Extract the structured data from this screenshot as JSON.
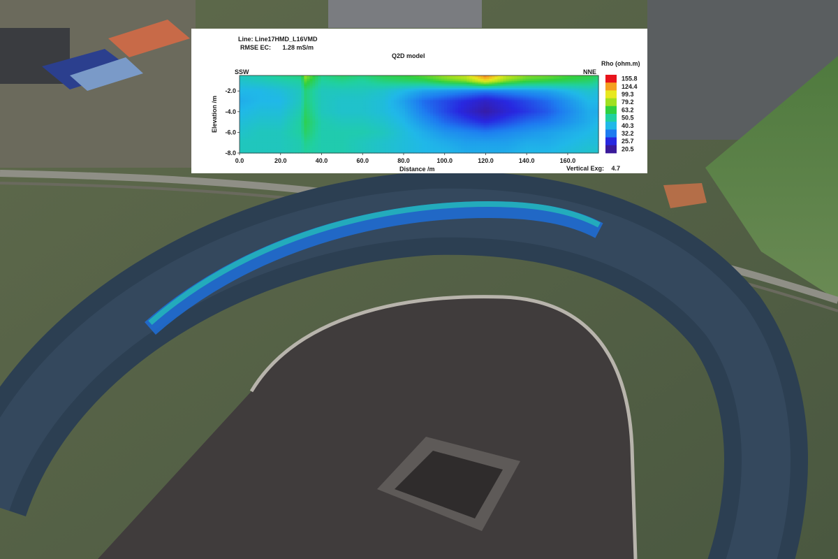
{
  "chart_data": {
    "type": "heatmap",
    "line_label": "Line:",
    "line_value": "Line17HMD_L16VMD",
    "rmse_label": "RMSE EC:",
    "rmse_value": "1.28 mS/m",
    "title": "Q2D model",
    "xlabel": "Distance /m",
    "ylabel": "Elevation /m",
    "left_direction": "SSW",
    "right_direction": "NNE",
    "colorbar_title": "Rho (ohm.m)",
    "vertical_exaggeration_label": "Vertical Exg:",
    "vertical_exaggeration_value": "4.7",
    "xlim": [
      0,
      175
    ],
    "ylim": [
      -8.0,
      -0.5
    ],
    "x_ticks": [
      {
        "value": 0,
        "label": "0.0"
      },
      {
        "value": 20,
        "label": "20.0"
      },
      {
        "value": 40,
        "label": "40.0"
      },
      {
        "value": 60,
        "label": "60.0"
      },
      {
        "value": 80,
        "label": "80.0"
      },
      {
        "value": 100,
        "label": "100.0"
      },
      {
        "value": 120,
        "label": "120.0"
      },
      {
        "value": 140,
        "label": "140.0"
      },
      {
        "value": 160,
        "label": "160.0"
      }
    ],
    "y_ticks": [
      {
        "value": -2.0,
        "label": "-2.0"
      },
      {
        "value": -4.0,
        "label": "-4.0"
      },
      {
        "value": -6.0,
        "label": "-6.0"
      },
      {
        "value": -8.0,
        "label": "-8.0"
      }
    ],
    "colorbar_values": [
      "155.8",
      "124.4",
      "99.3",
      "79.2",
      "63.2",
      "50.5",
      "40.3",
      "32.2",
      "25.7",
      "20.5"
    ],
    "colorbar_colors": [
      "#e8141c",
      "#f4a020",
      "#e8e820",
      "#a0e020",
      "#30d040",
      "#20d0a0",
      "#20b8e8",
      "#1e7cf0",
      "#2828e0",
      "#3a1a9a"
    ],
    "colorscale": [
      "#3a1a9a",
      "#2828e0",
      "#1e7cf0",
      "#20b8e8",
      "#20d0a0",
      "#30d040",
      "#a0e020",
      "#e8e820",
      "#f4a020",
      "#e8141c"
    ],
    "grid": false,
    "legend": "right",
    "x_centers": [
      0,
      10,
      20,
      30,
      32,
      40,
      50,
      60,
      70,
      80,
      90,
      100,
      110,
      120,
      130,
      140,
      150,
      160,
      170,
      175
    ],
    "depths": [
      -0.5,
      -1.0,
      -2.0,
      -3.0,
      -4.0,
      -5.0,
      -6.0,
      -7.0,
      -8.0
    ],
    "rho": [
      [
        3.6,
        3.8,
        4.2,
        4.4,
        6.0,
        4.2,
        4.6,
        4.4,
        4.8,
        5.0,
        5.4,
        6.0,
        6.6,
        8.4,
        6.6,
        5.8,
        5.6,
        5.2,
        5.0,
        4.6
      ],
      [
        3.4,
        3.6,
        3.8,
        4.0,
        5.4,
        4.0,
        4.2,
        4.0,
        4.4,
        4.6,
        4.8,
        5.4,
        5.8,
        7.2,
        5.8,
        5.2,
        5.0,
        4.8,
        4.6,
        4.2
      ],
      [
        3.0,
        3.0,
        3.2,
        3.6,
        4.4,
        3.6,
        3.6,
        3.6,
        3.4,
        3.0,
        2.6,
        2.4,
        2.2,
        2.0,
        2.2,
        2.4,
        2.6,
        3.0,
        3.4,
        3.2
      ],
      [
        2.8,
        3.0,
        3.0,
        3.6,
        4.4,
        3.6,
        3.4,
        3.4,
        3.2,
        2.6,
        1.8,
        1.4,
        1.0,
        0.6,
        1.0,
        1.4,
        1.8,
        2.4,
        3.0,
        3.0
      ],
      [
        3.0,
        3.2,
        3.2,
        3.8,
        4.6,
        3.6,
        3.4,
        3.4,
        3.2,
        2.8,
        2.0,
        1.4,
        0.8,
        0.2,
        0.8,
        1.2,
        1.6,
        2.2,
        2.8,
        2.8
      ],
      [
        3.2,
        3.4,
        3.4,
        4.0,
        4.8,
        3.8,
        3.6,
        3.6,
        3.4,
        3.0,
        2.4,
        1.8,
        1.4,
        1.0,
        1.4,
        1.8,
        2.0,
        2.4,
        2.8,
        3.0
      ],
      [
        3.4,
        3.6,
        3.6,
        4.0,
        4.6,
        3.8,
        3.8,
        3.8,
        3.6,
        3.2,
        2.8,
        2.4,
        2.2,
        2.0,
        2.2,
        2.4,
        2.6,
        2.8,
        3.0,
        3.2
      ],
      [
        3.6,
        3.6,
        3.6,
        3.8,
        4.2,
        3.8,
        3.8,
        3.6,
        3.4,
        3.2,
        3.0,
        2.8,
        2.6,
        2.6,
        2.6,
        2.8,
        2.8,
        3.0,
        3.2,
        3.2
      ],
      [
        3.6,
        3.6,
        3.6,
        3.8,
        4.0,
        3.8,
        3.8,
        3.6,
        3.4,
        3.2,
        3.0,
        3.0,
        2.8,
        2.8,
        2.8,
        3.0,
        3.0,
        3.2,
        3.4,
        3.4
      ]
    ]
  }
}
